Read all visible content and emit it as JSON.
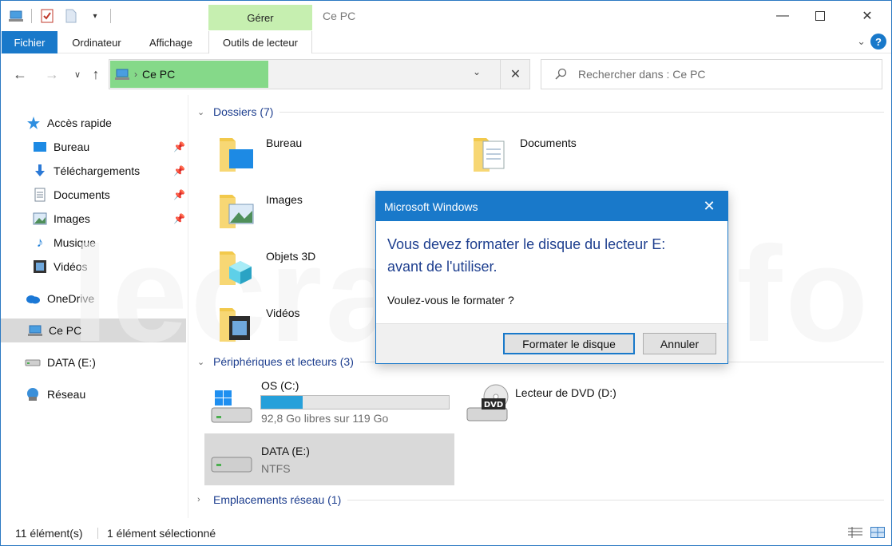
{
  "window": {
    "title": "Ce PC"
  },
  "ribbon": {
    "contextual_group": "Gérer",
    "tabs": [
      "Fichier",
      "Ordinateur",
      "Affichage",
      "Outils de lecteur"
    ],
    "help_label": "?"
  },
  "address": {
    "crumb": "Ce PC"
  },
  "search": {
    "placeholder": "Rechercher dans : Ce PC"
  },
  "sidebar": {
    "items": [
      {
        "label": "Accès rapide",
        "icon": "star-icon"
      },
      {
        "label": "Bureau",
        "icon": "desktop-icon",
        "pinned": true
      },
      {
        "label": "Téléchargements",
        "icon": "download-icon",
        "pinned": true
      },
      {
        "label": "Documents",
        "icon": "document-icon",
        "pinned": true
      },
      {
        "label": "Images",
        "icon": "image-icon",
        "pinned": true
      },
      {
        "label": "Musique",
        "icon": "music-icon"
      },
      {
        "label": "Vidéos",
        "icon": "video-icon"
      },
      {
        "label": "OneDrive",
        "icon": "cloud-icon"
      },
      {
        "label": "Ce PC",
        "icon": "computer-icon",
        "selected": true
      },
      {
        "label": "DATA (E:)",
        "icon": "drive-icon"
      },
      {
        "label": "Réseau",
        "icon": "network-icon"
      }
    ]
  },
  "main": {
    "folders_header": "Dossiers (7)",
    "folders": [
      "Bureau",
      "Documents",
      "Images",
      "Objets 3D",
      "Vidéos"
    ],
    "devices_header": "Périphériques et lecteurs (3)",
    "drives": [
      {
        "name": "OS (C:)",
        "detail": "92,8 Go libres sur 119 Go",
        "used_fraction": 0.22
      },
      {
        "name": "Lecteur de DVD (D:)"
      },
      {
        "name": "DATA (E:)",
        "detail": "NTFS",
        "selected": true
      }
    ],
    "network_header": "Emplacements réseau (1)"
  },
  "status": {
    "count": "11 élément(s)",
    "selection": "1 élément sélectionné"
  },
  "watermark": "lecrabe.info",
  "dialog": {
    "title": "Microsoft Windows",
    "main_line1": "Vous devez formater le disque du lecteur E:",
    "main_line2": "avant de l'utiliser.",
    "question": "Voulez-vous le formater ?",
    "format_button": "Formater le disque",
    "cancel_button": "Annuler"
  },
  "colors": {
    "accent": "#1979ca",
    "manage_tab": "#c6efb0",
    "breadcrumb": "#85d989",
    "drive_bar": "#26a0da"
  }
}
